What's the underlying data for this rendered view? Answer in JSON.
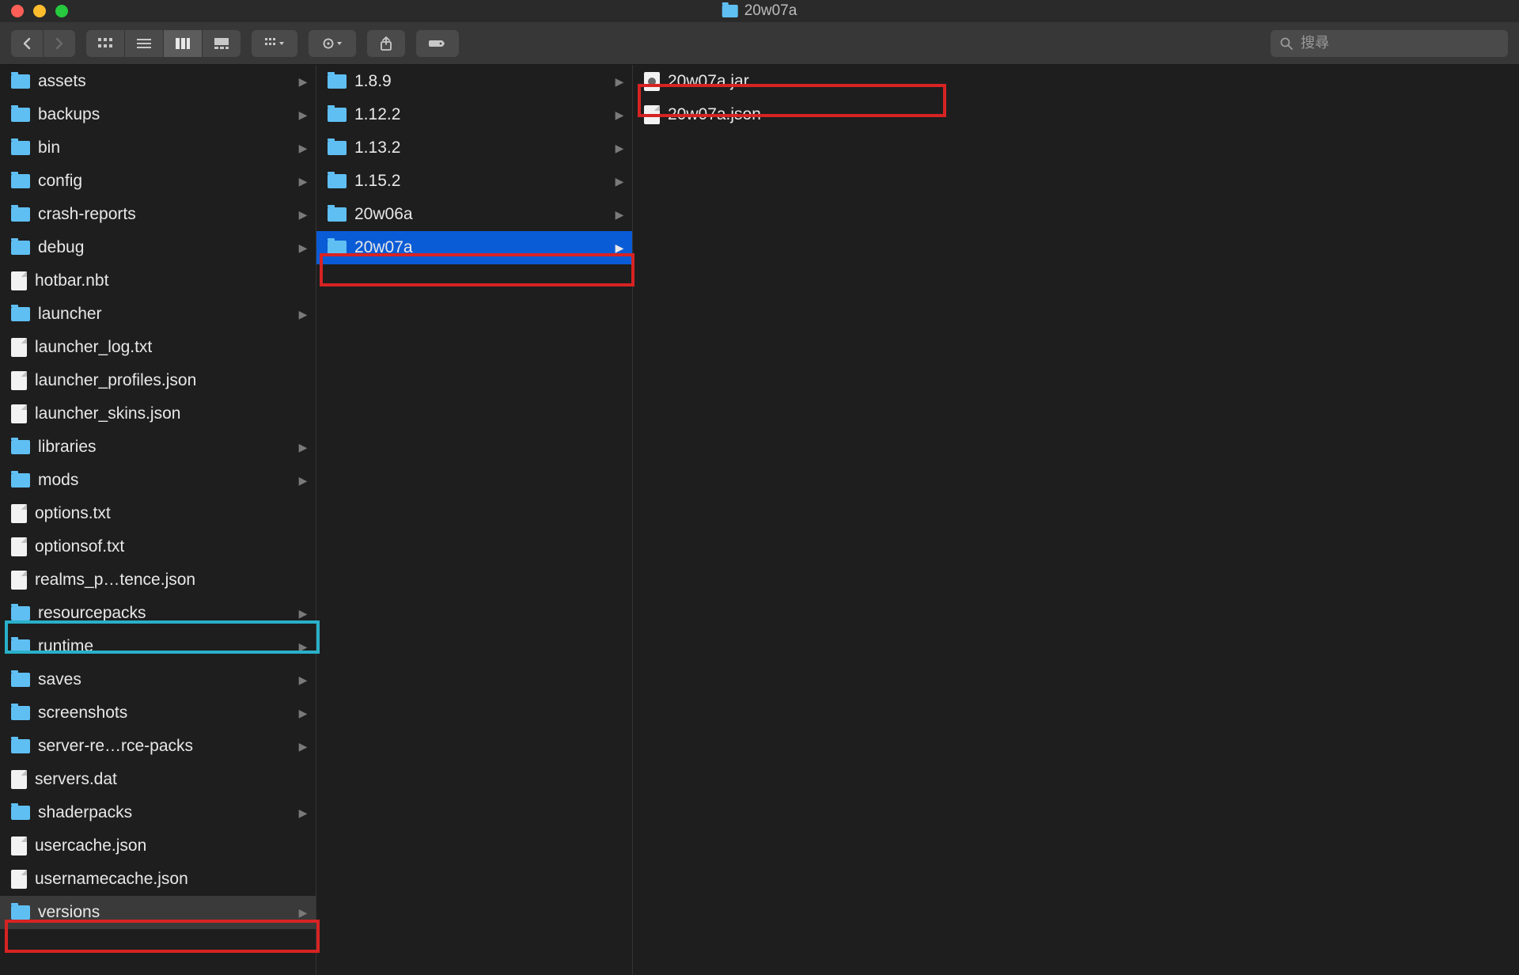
{
  "window": {
    "title": "20w07a"
  },
  "toolbar": {
    "search_placeholder": "搜尋"
  },
  "columns": {
    "col1": [
      {
        "name": "assets",
        "type": "folder",
        "hasChildren": true
      },
      {
        "name": "backups",
        "type": "folder",
        "hasChildren": true
      },
      {
        "name": "bin",
        "type": "folder",
        "hasChildren": true
      },
      {
        "name": "config",
        "type": "folder",
        "hasChildren": true
      },
      {
        "name": "crash-reports",
        "type": "folder",
        "hasChildren": true
      },
      {
        "name": "debug",
        "type": "folder",
        "hasChildren": true
      },
      {
        "name": "hotbar.nbt",
        "type": "file",
        "hasChildren": false
      },
      {
        "name": "launcher",
        "type": "folder",
        "hasChildren": true
      },
      {
        "name": "launcher_log.txt",
        "type": "file",
        "hasChildren": false
      },
      {
        "name": "launcher_profiles.json",
        "type": "file",
        "hasChildren": false
      },
      {
        "name": "launcher_skins.json",
        "type": "file",
        "hasChildren": false
      },
      {
        "name": "libraries",
        "type": "folder",
        "hasChildren": true
      },
      {
        "name": "mods",
        "type": "folder",
        "hasChildren": true
      },
      {
        "name": "options.txt",
        "type": "file",
        "hasChildren": false
      },
      {
        "name": "optionsof.txt",
        "type": "file",
        "hasChildren": false
      },
      {
        "name": "realms_p…tence.json",
        "type": "file",
        "hasChildren": false
      },
      {
        "name": "resourcepacks",
        "type": "folder",
        "hasChildren": true
      },
      {
        "name": "runtime",
        "type": "folder",
        "hasChildren": true
      },
      {
        "name": "saves",
        "type": "folder",
        "hasChildren": true
      },
      {
        "name": "screenshots",
        "type": "folder",
        "hasChildren": true
      },
      {
        "name": "server-re…rce-packs",
        "type": "folder",
        "hasChildren": true
      },
      {
        "name": "servers.dat",
        "type": "file",
        "hasChildren": false
      },
      {
        "name": "shaderpacks",
        "type": "folder",
        "hasChildren": true
      },
      {
        "name": "usercache.json",
        "type": "file",
        "hasChildren": false
      },
      {
        "name": "usernamecache.json",
        "type": "file",
        "hasChildren": false
      },
      {
        "name": "versions",
        "type": "folder",
        "hasChildren": true,
        "state": "dim-selected"
      }
    ],
    "col2": [
      {
        "name": "1.8.9",
        "type": "folder",
        "hasChildren": true
      },
      {
        "name": "1.12.2",
        "type": "folder",
        "hasChildren": true
      },
      {
        "name": "1.13.2",
        "type": "folder",
        "hasChildren": true
      },
      {
        "name": "1.15.2",
        "type": "folder",
        "hasChildren": true
      },
      {
        "name": "20w06a",
        "type": "folder",
        "hasChildren": true
      },
      {
        "name": "20w07a",
        "type": "folder",
        "hasChildren": true,
        "state": "selected"
      }
    ],
    "col3": [
      {
        "name": "20w07a.jar",
        "type": "jar",
        "hasChildren": false
      },
      {
        "name": "20w07a.json",
        "type": "file",
        "hasChildren": false
      }
    ]
  }
}
